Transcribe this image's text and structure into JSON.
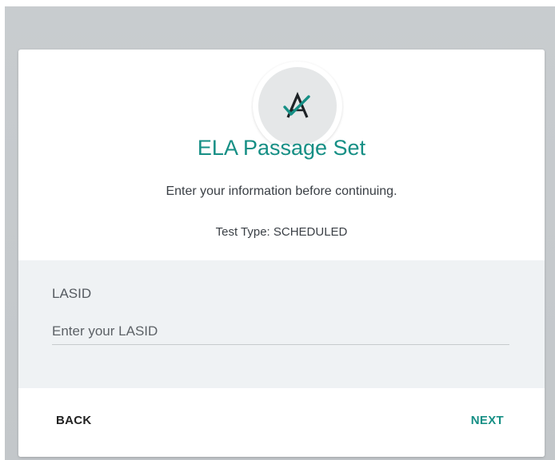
{
  "header": {
    "logo_icon": "a-check-logo-icon",
    "title": "ELA Passage Set",
    "subtitle": "Enter your information before continuing.",
    "test_type": "Test Type: SCHEDULED"
  },
  "form": {
    "lasid_label": "LASID",
    "lasid_placeholder": "Enter your LASID",
    "lasid_value": ""
  },
  "footer": {
    "back_label": "BACK",
    "next_label": "NEXT"
  },
  "colors": {
    "accent": "#168f85",
    "backdrop": "#c7cbce",
    "panel": "#eff2f4"
  }
}
